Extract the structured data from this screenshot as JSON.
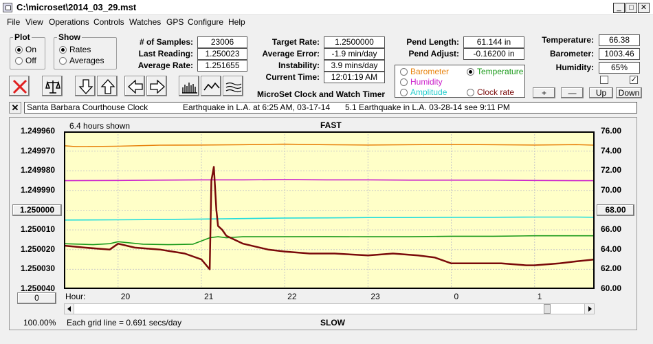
{
  "window": {
    "title": "C:\\microset\\2014_03_29.mst",
    "minimize": "_",
    "maximize": "□",
    "close": "✕"
  },
  "menu": [
    "File",
    "View",
    "Operations",
    "Controls",
    "Watches",
    "GPS",
    "Configure",
    "Help"
  ],
  "plot": {
    "legend": "Plot",
    "on": "On",
    "off": "Off",
    "selected": "On"
  },
  "show": {
    "legend": "Show",
    "rates": "Rates",
    "averages": "Averages",
    "selected": "Rates"
  },
  "stats": {
    "samples_label": "# of Samples:",
    "samples": "23006",
    "last_label": "Last Reading:",
    "last": "1.250023",
    "avg_rate_label": "Average Rate:",
    "avg_rate": "1.251655",
    "target_label": "Target Rate:",
    "target": "1.2500000",
    "avg_err_label": "Average Error:",
    "avg_err": "-1.9 min/day",
    "instab_label": "Instability:",
    "instab": "3.9 mins/day",
    "time_label": "Current Time:",
    "time": "12:01:19 AM",
    "pend_len_label": "Pend Length:",
    "pend_len": "61.144 in",
    "pend_adj_label": "Pend Adjust:",
    "pend_adj": "-0.16200 in",
    "temp_label": "Temperature:",
    "temp": "66.38",
    "baro_label": "Barometer:",
    "baro": "1003.46",
    "hum_label": "Humidity:",
    "hum": "65%"
  },
  "app_name": "MicroSet Clock and Watch Timer",
  "plot_select": {
    "barometer": "Barometer",
    "temperature": "Temperature",
    "humidity": "Humidity",
    "amplitude": "Amplitude",
    "clock_rate": "Clock rate",
    "selected": "Temperature"
  },
  "scale_buttons": {
    "plus": "+",
    "minus": "—",
    "up": "Up",
    "down": "Down"
  },
  "checkboxes": {
    "left": "",
    "right": "✓"
  },
  "colors": {
    "barometer": "#e8820c",
    "temperature": "#1a9a1a",
    "humidity": "#cc22cc",
    "amplitude": "#22dddd",
    "clock_rate": "#7a0a0a",
    "plot_bg": "#ffffc8"
  },
  "note_close": "✕",
  "notes": [
    {
      "text": "Santa Barbara Courthouse Clock"
    },
    {
      "text": "Earthquake in L.A. at 6:25 AM, 03-17-14"
    },
    {
      "text": "5.1 Earthquake in L.A. 03-28-14  see 9:11 PM"
    }
  ],
  "chart_header": {
    "hours_shown": "6.4 hours shown",
    "fast": "FAST",
    "slow": "SLOW",
    "left_btn": "1.250000",
    "right_btn": "68.00",
    "zero_btn": "0",
    "zoom": "100.00%",
    "grid_note": "Each grid line = 0.691 secs/day",
    "hour_label": "Hour:"
  },
  "chart_data": {
    "type": "line",
    "x_label": "Hour:",
    "x_ticks": [
      "20",
      "21",
      "22",
      "23",
      "0",
      "1"
    ],
    "left_axis": {
      "ticks": [
        "1.249960",
        "1.249970",
        "1.249980",
        "1.249990",
        "1.250000",
        "1.250010",
        "1.250020",
        "1.250030",
        "1.250040"
      ],
      "range": [
        1.24996,
        1.25004
      ],
      "inverted": true
    },
    "right_axis": {
      "ticks": [
        "76.00",
        "74.00",
        "72.00",
        "70.00",
        "68.00",
        "66.00",
        "64.00",
        "62.00",
        "60.00"
      ],
      "range": [
        60,
        76
      ]
    },
    "grid": true,
    "series": [
      {
        "name": "Barometer",
        "color": "#e8820c",
        "axis": "right",
        "x": [
          19.35,
          19.5,
          20,
          20.5,
          21,
          21.5,
          22,
          22.5,
          23,
          23.5,
          0,
          0.5,
          1,
          1.5,
          1.72
        ],
        "y": [
          74.55,
          74.45,
          74.5,
          74.6,
          74.62,
          74.65,
          74.7,
          74.65,
          74.62,
          74.65,
          74.68,
          74.65,
          74.62,
          74.66,
          74.6
        ]
      },
      {
        "name": "Humidity",
        "color": "#cc22cc",
        "axis": "right",
        "x": [
          19.35,
          20,
          20.5,
          21,
          21.5,
          22,
          22.5,
          23,
          23.5,
          0,
          0.5,
          1,
          1.5,
          1.72
        ],
        "y": [
          71.0,
          71.02,
          71.05,
          71.08,
          71.08,
          71.1,
          71.08,
          71.08,
          71.05,
          71.05,
          71.05,
          71.02,
          71.0,
          71.0
        ]
      },
      {
        "name": "Amplitude",
        "color": "#22dddd",
        "axis": "right",
        "x": [
          19.35,
          20,
          20.5,
          21,
          21.5,
          22,
          22.5,
          23,
          23.5,
          0,
          0.5,
          1,
          1.5,
          1.72
        ],
        "y": [
          67.0,
          67.02,
          67.05,
          67.1,
          67.15,
          67.2,
          67.22,
          67.25,
          67.25,
          67.28,
          67.28,
          67.3,
          67.3,
          67.28
        ]
      },
      {
        "name": "Temperature",
        "color": "#1a9a1a",
        "axis": "right",
        "x": [
          19.35,
          19.7,
          19.9,
          20,
          20.3,
          20.6,
          20.9,
          21.1,
          21.2,
          21.3,
          21.5,
          22,
          22.5,
          23,
          23.5,
          0,
          0.5,
          1,
          1.5,
          1.72
        ],
        "y": [
          64.6,
          64.5,
          64.6,
          64.8,
          64.55,
          64.5,
          64.55,
          65.2,
          65.3,
          65.2,
          65.3,
          65.3,
          65.32,
          65.3,
          65.3,
          65.35,
          65.35,
          65.4,
          65.4,
          65.4
        ]
      },
      {
        "name": "Clock rate",
        "color": "#7a0a0a",
        "axis": "left",
        "x": [
          19.35,
          19.6,
          19.9,
          20,
          20.2,
          20.5,
          20.8,
          21.0,
          21.1,
          21.12,
          21.15,
          21.18,
          21.2,
          21.25,
          21.3,
          21.5,
          21.8,
          22,
          22.3,
          22.6,
          23,
          23.3,
          23.6,
          23.8,
          0,
          0.3,
          0.6,
          0.9,
          1,
          1.3,
          1.5,
          1.72
        ],
        "y": [
          1.250018,
          1.250019,
          1.25002,
          1.250017,
          1.250019,
          1.25002,
          1.250022,
          1.250025,
          1.25003,
          1.249985,
          1.249978,
          1.25,
          1.250008,
          1.25001,
          1.250013,
          1.250017,
          1.25002,
          1.250021,
          1.250022,
          1.250022,
          1.250023,
          1.250022,
          1.250023,
          1.250024,
          1.250027,
          1.250027,
          1.250027,
          1.250028,
          1.250028,
          1.250027,
          1.250026,
          1.250025
        ]
      }
    ]
  }
}
